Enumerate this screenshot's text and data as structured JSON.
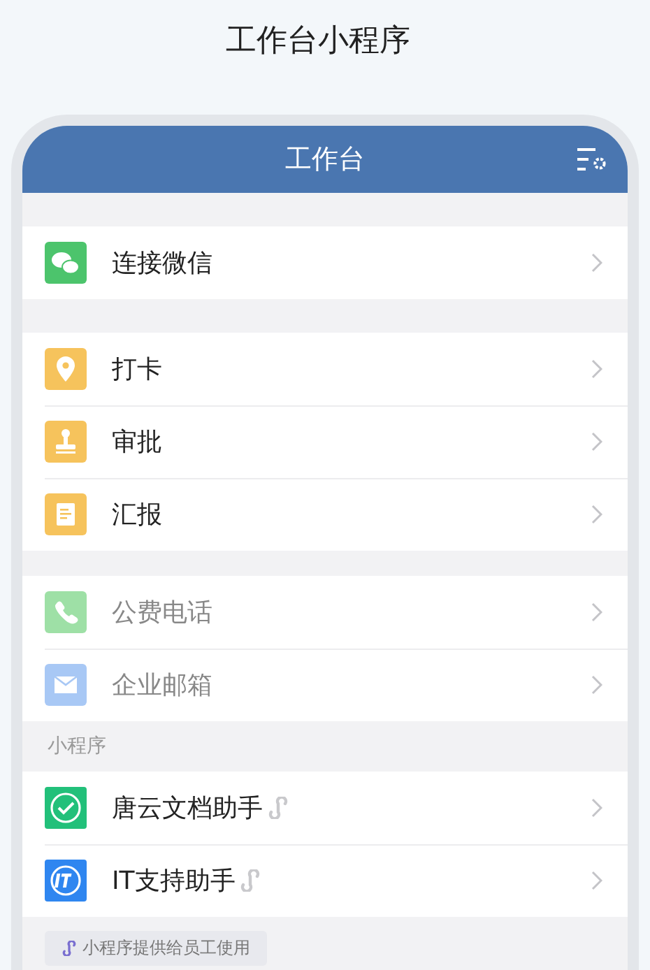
{
  "page_title": "工作台小程序",
  "header": {
    "title": "工作台"
  },
  "groups": [
    {
      "items": [
        {
          "label": "连接微信",
          "disabled": false,
          "color": "#4cc46c"
        }
      ]
    },
    {
      "items": [
        {
          "label": "打卡",
          "disabled": false,
          "color": "#f6c35c"
        },
        {
          "label": "审批",
          "disabled": false,
          "color": "#f6c35c"
        },
        {
          "label": "汇报",
          "disabled": false,
          "color": "#f6c35c"
        }
      ]
    },
    {
      "items": [
        {
          "label": "公费电话",
          "disabled": true,
          "color": "#9ee0a6"
        },
        {
          "label": "企业邮箱",
          "disabled": true,
          "color": "#a8c8f5"
        }
      ]
    }
  ],
  "mini_programs": {
    "heading": "小程序",
    "items": [
      {
        "label": "唐云文档助手",
        "color": "#22c07a"
      },
      {
        "label": "IT支持助手",
        "color": "#2f86f0"
      }
    ]
  },
  "footer": {
    "text": "小程序提供给员工使用"
  }
}
